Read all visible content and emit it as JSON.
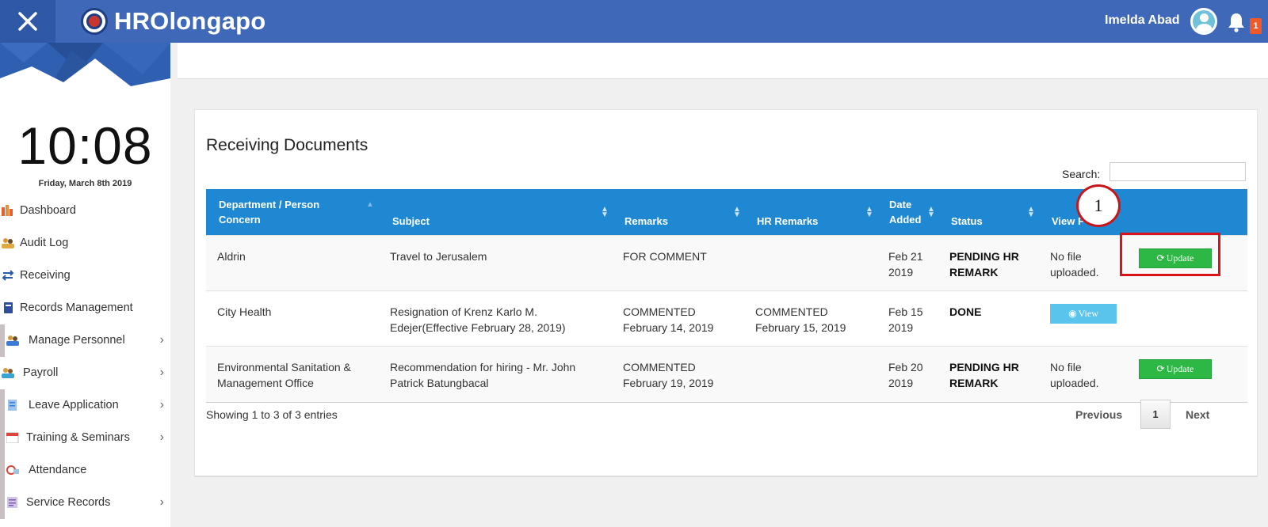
{
  "app": {
    "brand": "HROlongapo",
    "user_name": "Imelda Abad",
    "notification_count": "1"
  },
  "sidebar": {
    "clock": "10:08",
    "date": "Friday, March 8th 2019",
    "items": [
      {
        "label": "Dashboard",
        "icon": "dashboard-icon",
        "chevron": ""
      },
      {
        "label": "Audit Log",
        "icon": "audit-log-icon",
        "chevron": ""
      },
      {
        "label": "Receiving",
        "icon": "receiving-icon",
        "chevron": ""
      },
      {
        "label": "Records Management",
        "icon": "records-icon",
        "chevron": ""
      },
      {
        "label": "Manage Personnel",
        "icon": "personnel-icon",
        "chevron": "›"
      },
      {
        "label": "Payroll",
        "icon": "payroll-icon",
        "chevron": "›"
      },
      {
        "label": "Leave Application",
        "icon": "leave-icon",
        "chevron": "›"
      },
      {
        "label": "Training & Seminars",
        "icon": "calendar-icon",
        "chevron": "›"
      },
      {
        "label": "Attendance",
        "icon": "attendance-icon",
        "chevron": ""
      },
      {
        "label": "Service Records",
        "icon": "service-records-icon",
        "chevron": "›"
      }
    ]
  },
  "panel": {
    "title": "Receiving Documents",
    "search_label": "Search:",
    "search_value": ""
  },
  "table": {
    "headers": [
      "Department / Person Concern",
      "Subject",
      "Remarks",
      "HR Remarks",
      "Date Added",
      "Status",
      "View F"
    ],
    "rows": [
      {
        "department": "Aldrin",
        "subject": "Travel to Jerusalem",
        "remarks": "FOR COMMENT",
        "hr_remarks": "",
        "date_added": "Feb 21 2019",
        "status": "PENDING HR REMARK",
        "view_file": "No file uploaded.",
        "action": "Update"
      },
      {
        "department": "City Health",
        "subject": "Resignation of Krenz Karlo M. Edejer(Effective February 28, 2019)",
        "remarks": "COMMENTED February 14, 2019",
        "hr_remarks": "COMMENTED February 15, 2019",
        "date_added": "Feb 15 2019",
        "status": "DONE",
        "view_file": "View",
        "action": ""
      },
      {
        "department": "Environmental Sanitation & Management Office",
        "subject": "Recommendation for hiring - Mr. John Patrick Batungbacal",
        "remarks": "COMMENTED February 19, 2019",
        "hr_remarks": "",
        "date_added": "Feb 20 2019",
        "status": "PENDING HR REMARK",
        "view_file": "No file uploaded.",
        "action": "Update"
      }
    ]
  },
  "pagination": {
    "info": "Showing 1 to 3 of 3 entries",
    "previous": "Previous",
    "page": "1",
    "next": "Next"
  },
  "annotation": {
    "callout": "1"
  },
  "colors": {
    "topbar": "#3f69b8",
    "table_header": "#1e88d2",
    "update_button": "#2db744",
    "view_button": "#5bc4ec",
    "highlight": "#d9121b"
  }
}
